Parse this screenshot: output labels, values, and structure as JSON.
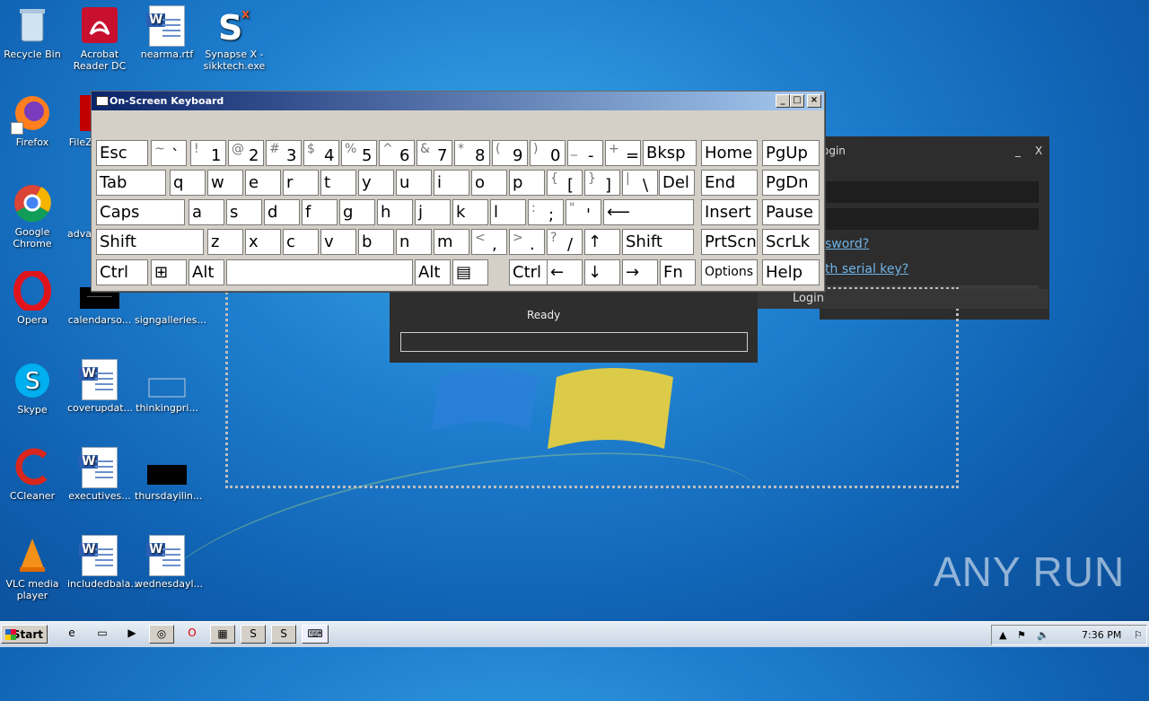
{
  "desktop": {
    "icons": [
      {
        "label": "Recycle Bin"
      },
      {
        "label": "Acrobat\nReader DC"
      },
      {
        "label": "nearma.rtf"
      },
      {
        "label": "Synapse X -\nsikktech.exe"
      },
      {
        "label": "Firefox"
      },
      {
        "label": "FileZ..."
      },
      {
        "label": "Google\nChrome"
      },
      {
        "label": "adva..."
      },
      {
        "label": "Opera"
      },
      {
        "label": "calendarso..."
      },
      {
        "label": "signgalleries..."
      },
      {
        "label": "Skype"
      },
      {
        "label": "coverupdat..."
      },
      {
        "label": "thinkingpri..."
      },
      {
        "label": "CCleaner"
      },
      {
        "label": "executives..."
      },
      {
        "label": "thursdayilin..."
      },
      {
        "label": "VLC media\nplayer"
      },
      {
        "label": "includedbala..."
      },
      {
        "label": "wednesdayl..."
      }
    ]
  },
  "osk": {
    "title": "On-Screen Keyboard",
    "min": "_",
    "max": "□",
    "close": "×",
    "row1": [
      {
        "label": "Esc"
      },
      {
        "sup": "~",
        "main": "`"
      },
      {
        "sup": "!",
        "main": "1"
      },
      {
        "sup": "@",
        "main": "2"
      },
      {
        "sup": "#",
        "main": "3"
      },
      {
        "sup": "$",
        "main": "4"
      },
      {
        "sup": "%",
        "main": "5"
      },
      {
        "sup": "^",
        "main": "6"
      },
      {
        "sup": "&",
        "main": "7"
      },
      {
        "sup": "*",
        "main": "8"
      },
      {
        "sup": "(",
        "main": "9"
      },
      {
        "sup": ")",
        "main": "0"
      },
      {
        "sup": "_",
        "main": "-"
      },
      {
        "sup": "+",
        "main": "="
      },
      {
        "label": "Bksp"
      },
      {
        "label": "Home"
      },
      {
        "label": "PgUp"
      }
    ],
    "row2": [
      {
        "label": "Tab"
      },
      {
        "label": "q"
      },
      {
        "label": "w"
      },
      {
        "label": "e"
      },
      {
        "label": "r"
      },
      {
        "label": "t"
      },
      {
        "label": "y"
      },
      {
        "label": "u"
      },
      {
        "label": "i"
      },
      {
        "label": "o"
      },
      {
        "label": "p"
      },
      {
        "sup": "{",
        "main": "["
      },
      {
        "sup": "}",
        "main": "]"
      },
      {
        "sup": "|",
        "main": "\\"
      },
      {
        "label": "Del"
      },
      {
        "label": "End"
      },
      {
        "label": "PgDn"
      }
    ],
    "row3": [
      {
        "label": "Caps"
      },
      {
        "label": "a"
      },
      {
        "label": "s"
      },
      {
        "label": "d"
      },
      {
        "label": "f"
      },
      {
        "label": "g"
      },
      {
        "label": "h"
      },
      {
        "label": "j"
      },
      {
        "label": "k"
      },
      {
        "label": "l"
      },
      {
        "sup": ":",
        "main": ";"
      },
      {
        "sup": "\"",
        "main": "'"
      },
      {
        "label": "⟵"
      },
      {
        "label": "Insert"
      },
      {
        "label": "Pause"
      }
    ],
    "row4": [
      {
        "label": "Shift"
      },
      {
        "label": "z"
      },
      {
        "label": "x"
      },
      {
        "label": "c"
      },
      {
        "label": "v"
      },
      {
        "label": "b"
      },
      {
        "label": "n"
      },
      {
        "label": "m"
      },
      {
        "sup": "<",
        "main": ","
      },
      {
        "sup": ">",
        "main": "."
      },
      {
        "sup": "?",
        "main": "/"
      },
      {
        "label": "↑"
      },
      {
        "label": "Shift"
      },
      {
        "label": "PrtScn"
      },
      {
        "label": "ScrLk"
      }
    ],
    "row5": [
      {
        "label": "Ctrl"
      },
      {
        "label": "⊞"
      },
      {
        "label": "Alt"
      },
      {
        "label": ""
      },
      {
        "label": "Alt"
      },
      {
        "label": "▤"
      },
      {
        "label": "Ctrl"
      },
      {
        "label": "←"
      },
      {
        "label": "↓"
      },
      {
        "label": "→"
      },
      {
        "label": "Fn"
      },
      {
        "label": "Options"
      },
      {
        "label": "Help"
      }
    ]
  },
  "login": {
    "title": "ogin",
    "min": "_",
    "close": "X",
    "forgot": "sword?",
    "serial": "th serial key?",
    "button": "Login"
  },
  "ready": {
    "status": "Ready"
  },
  "taskbar": {
    "start": "Start",
    "clock": "7:36 PM"
  },
  "watermark": "ANY  RUN"
}
